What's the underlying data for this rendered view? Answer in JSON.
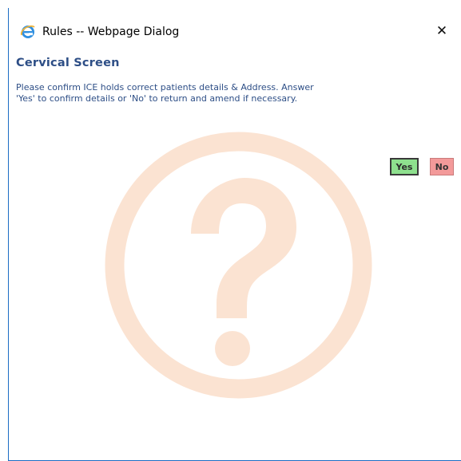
{
  "window": {
    "title": "Rules -- Webpage Dialog",
    "close_glyph": "✕",
    "app_icon": "internet-explorer-icon"
  },
  "dialog": {
    "heading": "Cervical Screen",
    "message": "Please confirm ICE holds correct patients details & Address. Answer\n'Yes' to confirm details or 'No' to return and amend if necessary.",
    "watermark_icon": "question-mark-icon"
  },
  "buttons": {
    "yes_label": "Yes",
    "no_label": "No"
  },
  "colors": {
    "heading_text": "#2d4e86",
    "yes_background": "#8ee08e",
    "no_background": "#f39a9a",
    "watermark": "#fbe3d2",
    "window_border": "#1b6cc4"
  }
}
